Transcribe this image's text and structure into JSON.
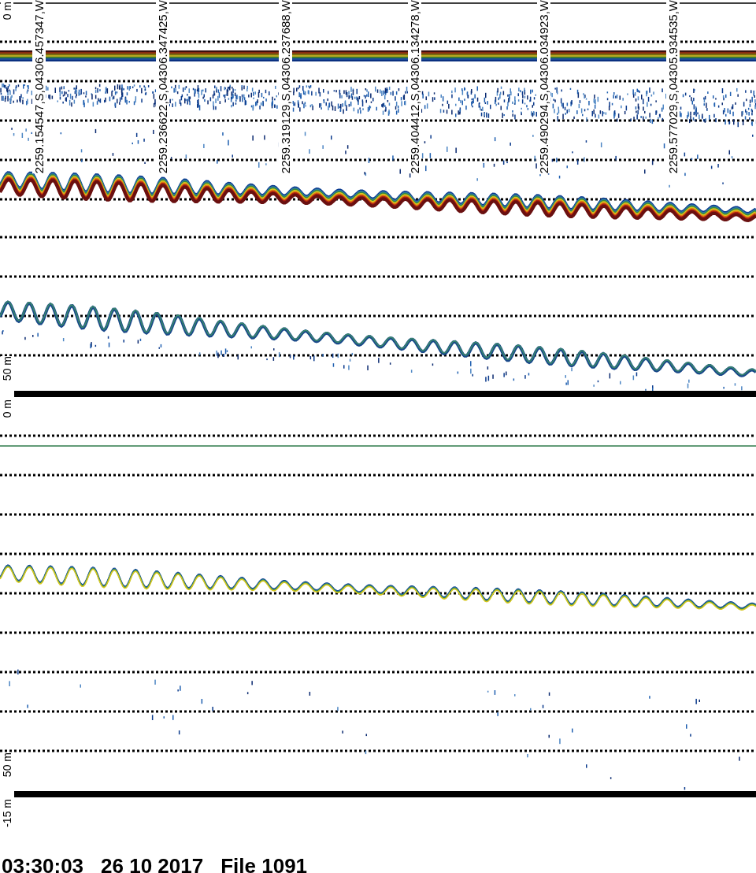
{
  "echogram_panels": [
    {
      "depth_top": "0 m",
      "depth_bottom": "50 m",
      "position_labels": [
        "2259.154547,S,04306.457347,W",
        "2259.236622,S,04306.347425,W",
        "2259.319129,S,04306.237688,W",
        "2259.404412,S,04306.134278,W",
        "2259.490294,S,04306.034923,W",
        "2259.577029,S,04305.934535,W"
      ]
    },
    {
      "depth_top": "0 m",
      "depth_bottom": "50 m"
    }
  ],
  "offset_label": "-15 m",
  "status": {
    "time": "03:30:03",
    "date": "26 10 2017",
    "file": "File 1091"
  }
}
